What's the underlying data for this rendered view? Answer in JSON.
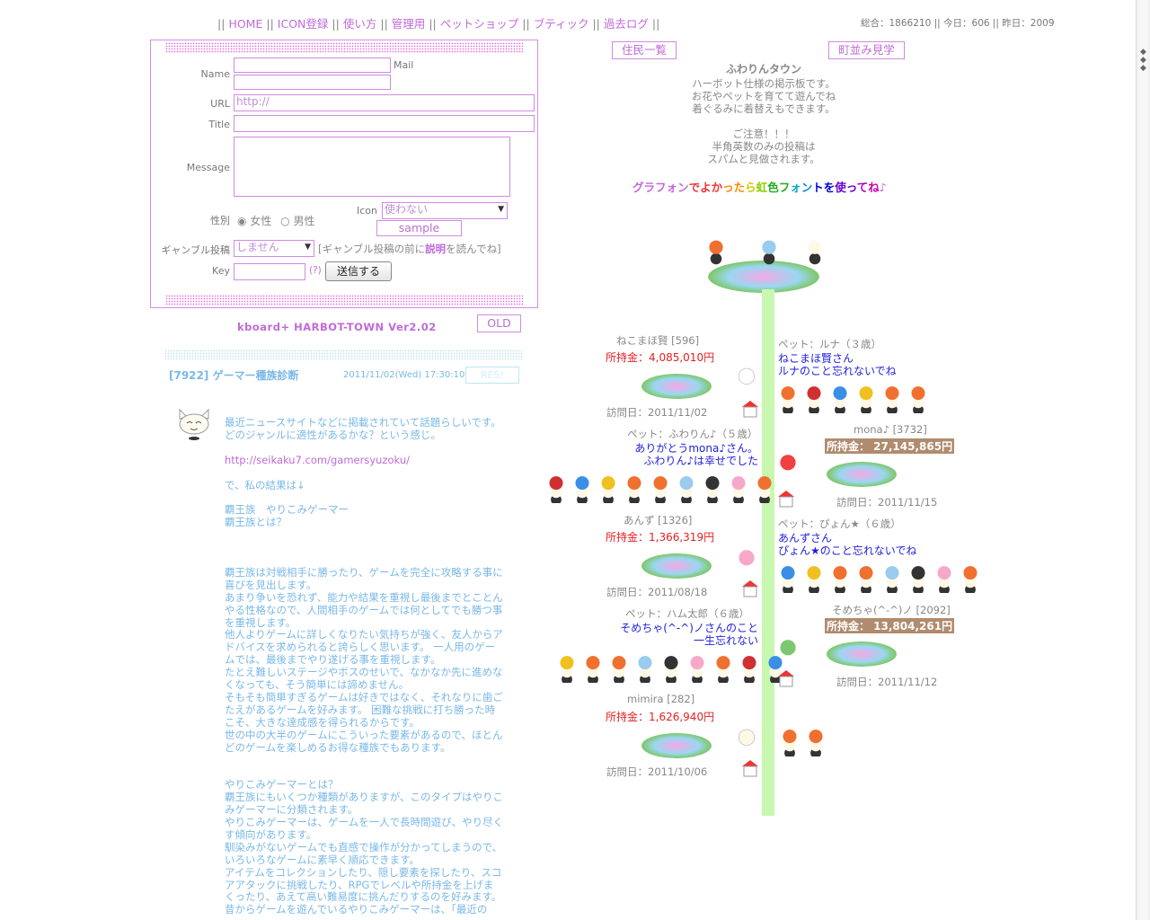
{
  "nav": {
    "items": [
      "HOME",
      "ICON登録",
      "使い方",
      "管理用",
      "ペットショップ",
      "ブティック",
      "過去ログ"
    ],
    "counter": "総合：1866210 || 今日：606 || 昨日：2009"
  },
  "form": {
    "name_label": "Name",
    "mail_label": "Mail",
    "url_label": "URL",
    "url_value": "http://",
    "title_label": "Title",
    "message_label": "Message",
    "gender_label": "性別",
    "gender_female": "女性",
    "gender_male": "男性",
    "icon_label": "Icon",
    "icon_value": "使わない",
    "sample_button": "sample",
    "gamble_label": "ギャンブル投稿",
    "gamble_value": "しません",
    "gamble_note_pre": "[ギャンブル投稿の前に",
    "gamble_note_link": "説明",
    "gamble_note_post": "を読んでね]",
    "key_label": "Key",
    "key_help": "(?)",
    "submit_button": "送信する"
  },
  "board": {
    "title": "kboard+ HARBOT-TOWN Ver2.02",
    "old_button": "OLD"
  },
  "post": {
    "title": "[7922] ゲーマー種族診断",
    "date": "2011/11/02(Wed) 17:30:10",
    "res_button": "RES!",
    "p1": "最近ニュースサイトなどに掲載されていて話題らしいです。\nどのジャンルに適性があるかな？という感じ。",
    "link": "http://seikaku7.com/gamersyuzoku/",
    "p2": "で、私の結果は↓\n\n覇王族　やりこみゲーマー\n覇王族とは？\n\n\n\n覇王族は対戦相手に勝ったり、ゲームを完全に攻略する事に\n喜びを見出します。\nあまり争いを恐れず、能力や結果を重視し最後までとことん\nやる性格なので、人間相手のゲームでは何としてでも勝つ事\nを重視します。\n他人よりゲームに詳しくなりたい気持ちが強く、友人からア\nドバイスを求められると誇らしく思います。 一人用のゲー\nムでは、最後までやり遂げる事を重視します。\nたとえ難しいステージやボスのせいで、なかなか先に進めな\nくなっても、そう簡単には諦めません。\nそもそも簡単すぎるゲームは好きではなく、それなりに歯ご\nたえがあるゲームを好みます。 困難な挑戦に打ち勝った時\nこそ、大きな達成感を得られるからです。\n世の中の大半のゲームにこういった要素があるので、ほとん\nどのゲームを楽しめるお得な種族でもあります。\n\n\nやりこみゲーマーとは？\n覇王族にもいくつか種類がありますが、このタイプはやりこ\nみゲーマーに分類されます。\nやりこみゲーマーは、ゲームを一人で長時間遊び、やり尽く\nす傾向があります。\n馴染みがないゲームでも直感で操作が分かってしまうので、\nいろいろなゲームに素早く順応できます。\nアイテムをコレクションしたり、隠し要素を探したり、スコ\nアアタックに挑戦したり、RPGでレベルや所持金を上げま\nくったり、あえて高い難易度に挑んだりするのを好みます。\n昔からゲームを遊んでいるやりこみゲーマーは、「最近の"
  },
  "town": {
    "residents_button": "住民一覧",
    "tour_button": "町並み見学",
    "name": "ふわりんタウン",
    "desc": "ハーボット仕様の掲示板です。\nお花やペットを育てて遊んでね\n着ぐるみに着替えもできます。\n\nご注意！！！\n半角英数のみの投稿は\nスパムと見做されます。",
    "rainbow": "グラフォンでよかったら虹色フォントを使ってね♪"
  },
  "residents": [
    {
      "name": "ねこまほ賢 [596]",
      "money": "所持金：4,085,010円",
      "visit": "訪問日：2011/11/02",
      "pet": "ペット：ルナ（３歳）",
      "msg": "ねこまほ賢さん\nルナのこと忘れないでね"
    },
    {
      "name": "mona♪ [3732]",
      "money": "所持金： 27,145,865円",
      "visit": "訪問日：2011/11/15",
      "pet": "ペット：ふわりん♪（５歳）",
      "msg": "ありがとうmona♪さん。\nふわりん♪は幸せでした"
    },
    {
      "name": "あんず [1326]",
      "money": "所持金：1,366,319円",
      "visit": "訪問日：2011/08/18",
      "pet": "ペット：ぴょん★（６歳）",
      "msg": "あんずさん\nぴょん★のこと忘れないでね"
    },
    {
      "name": "そめちゃ(^-^)ノ [2092]",
      "money": "所持金： 13,804,261円",
      "visit": "訪問日：2011/11/12",
      "pet": "ペット：ハム太郎（６歳）",
      "msg": "そめちゃ(^-^)ノさんのこと\n一生忘れない"
    },
    {
      "name": "mimira [282]",
      "money": "所持金：1,626,940円",
      "visit": "訪問日：2011/10/06"
    }
  ],
  "colors": {
    "accent": "#c06ad8",
    "post_text": "#7ab8e6",
    "money_red": "#e52020",
    "stem": "#c8f7b0"
  }
}
